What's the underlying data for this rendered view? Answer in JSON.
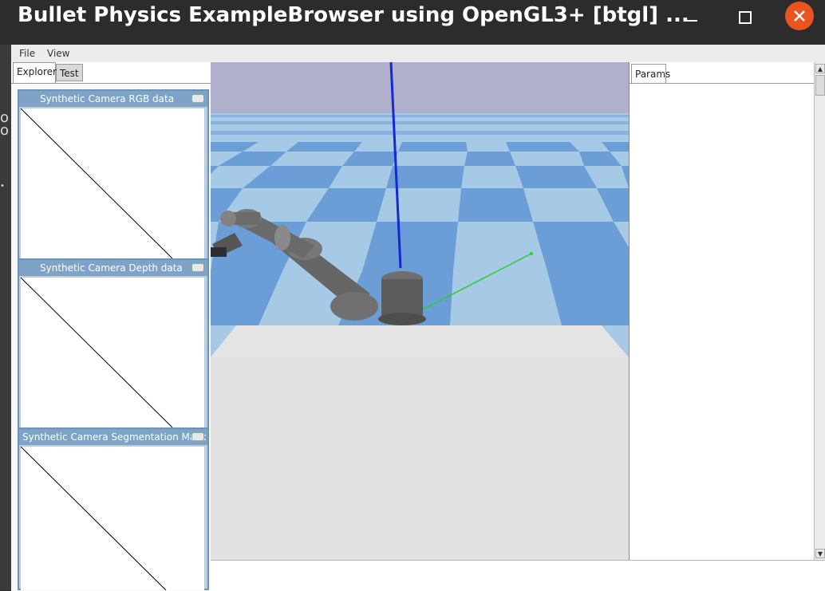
{
  "window": {
    "title": "Bullet Physics ExampleBrowser using OpenGL3+ [btgl] ..."
  },
  "menu": {
    "file": "File",
    "view": "View"
  },
  "tabs": {
    "explorer": "Explorer",
    "test": "Test",
    "params": "Params"
  },
  "camera_panels": [
    {
      "title": "Synthetic Camera RGB data"
    },
    {
      "title": "Synthetic Camera Depth data"
    },
    {
      "title": "Synthetic Camera Segmentation Mask"
    }
  ],
  "colors": {
    "title_bar": "#2c2c2c",
    "close_button": "#e95420",
    "sky": "#b0b0cc",
    "floor_light": "#a6c9e6",
    "floor_dark": "#6b9ed6",
    "panel_title": "#7ea3c7",
    "axis_z": "#1428d8",
    "axis_y": "#28d028",
    "table": "#e4e4e4"
  },
  "icons": {
    "minimize": "minimize-icon",
    "maximize": "maximize-icon",
    "close": "close-icon"
  }
}
